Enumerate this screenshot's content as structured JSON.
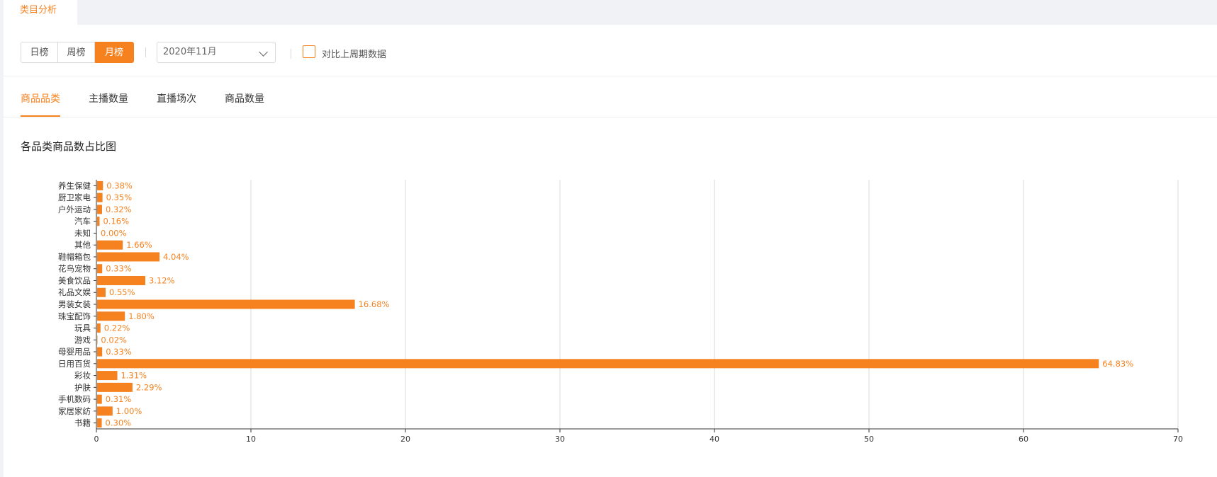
{
  "header": {
    "tab_label": "类目分析"
  },
  "toolbar": {
    "periods": [
      "日榜",
      "周榜",
      "月榜"
    ],
    "active_period": "月榜",
    "date_value": "2020年11月",
    "compare_label": "对比上周期数据",
    "compare_checked": false
  },
  "tabs": [
    "商品品类",
    "主播数量",
    "直播场次",
    "商品数量"
  ],
  "active_tab": "商品品类",
  "colors": {
    "accent": "#f5821f",
    "grid": "#d9d9d9"
  },
  "chart_data": {
    "type": "bar",
    "orientation": "horizontal",
    "title": "各品类商品数占比图",
    "categories": [
      "养生保健",
      "厨卫家电",
      "户外运动",
      "汽车",
      "未知",
      "其他",
      "鞋帽箱包",
      "花鸟宠物",
      "美食饮品",
      "礼品文娱",
      "男装女装",
      "珠宝配饰",
      "玩具",
      "游戏",
      "母婴用品",
      "日用百货",
      "彩妆",
      "护肤",
      "手机数码",
      "家居家纺",
      "书籍"
    ],
    "values": [
      0.38,
      0.35,
      0.32,
      0.16,
      0.0,
      1.66,
      4.04,
      0.33,
      3.12,
      0.55,
      16.68,
      1.8,
      0.22,
      0.02,
      0.33,
      64.83,
      1.31,
      2.29,
      0.31,
      1.0,
      0.3
    ],
    "value_labels": [
      "0.38%",
      "0.35%",
      "0.32%",
      "0.16%",
      "0.00%",
      "1.66%",
      "4.04%",
      "0.33%",
      "3.12%",
      "0.55%",
      "16.68%",
      "1.80%",
      "0.22%",
      "0.02%",
      "0.33%",
      "64.83%",
      "1.31%",
      "2.29%",
      "0.31%",
      "1.00%",
      "0.30%"
    ],
    "xlim": [
      0,
      70
    ],
    "xticks": [
      0,
      10,
      20,
      30,
      40,
      50,
      60,
      70
    ],
    "grid": true,
    "xlabel": "",
    "ylabel": ""
  }
}
